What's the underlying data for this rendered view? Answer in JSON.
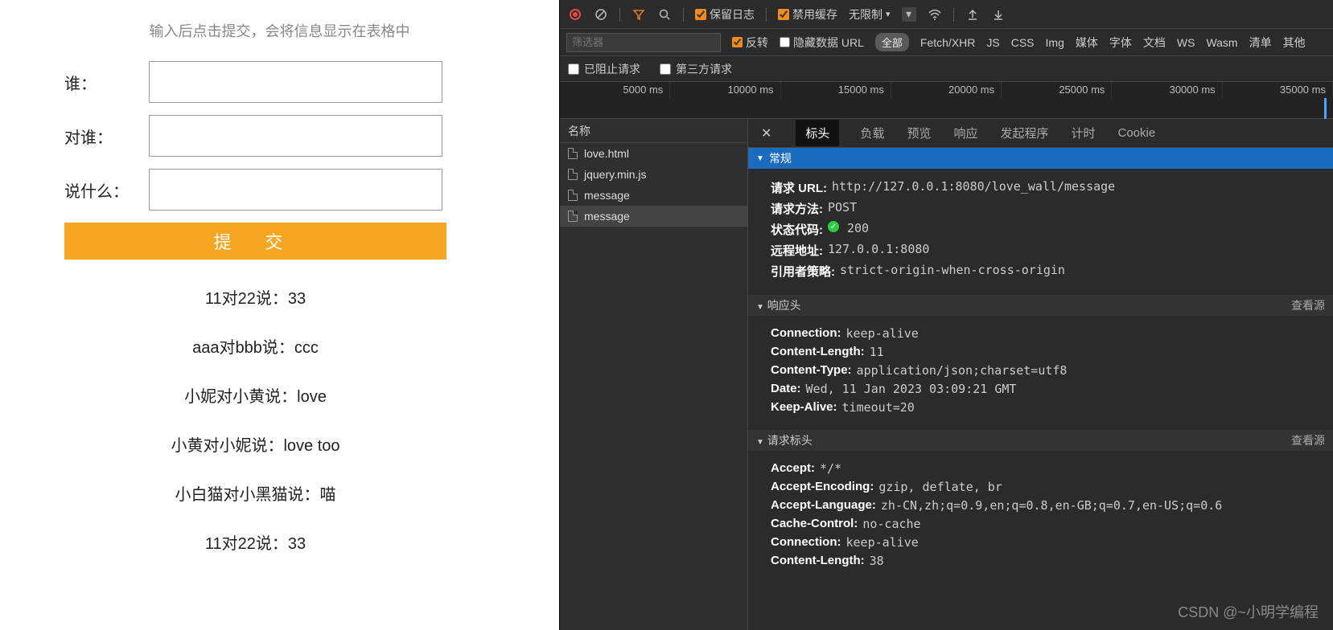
{
  "form": {
    "subtitle": "输入后点击提交，会将信息显示在表格中",
    "labels": {
      "who": "谁：",
      "toWhom": "对谁：",
      "sayWhat": "说什么："
    },
    "submit": "提 交",
    "messages": [
      "11对22说：33",
      "aaa对bbb说：ccc",
      "小妮对小黄说：love",
      "小黄对小妮说：love too",
      "小白猫对小黑猫说：喵",
      "11对22说：33"
    ]
  },
  "toolbar": {
    "preserveLog": "保留日志",
    "disableCache": "禁用缓存",
    "throttle": "无限制"
  },
  "filterbar": {
    "placeholder": "筛选器",
    "invert": "反转",
    "hideDataUrl": "隐藏数据 URL",
    "all": "全部",
    "types": [
      "Fetch/XHR",
      "JS",
      "CSS",
      "Img",
      "媒体",
      "字体",
      "文档",
      "WS",
      "Wasm",
      "清单",
      "其他"
    ]
  },
  "optbar": {
    "blocked": "已阻止请求",
    "thirdParty": "第三方请求"
  },
  "timeline": [
    "5000 ms",
    "10000 ms",
    "15000 ms",
    "20000 ms",
    "25000 ms",
    "30000 ms",
    "35000 ms"
  ],
  "requests": {
    "header": "名称",
    "items": [
      "love.html",
      "jquery.min.js",
      "message",
      "message"
    ],
    "selectedIndex": 3
  },
  "detailTabs": {
    "headers": "标头",
    "payload": "负载",
    "preview": "预览",
    "response": "响应",
    "initiator": "发起程序",
    "timing": "计时",
    "cookies": "Cookie"
  },
  "sections": {
    "general": "常规",
    "responseHeaders": "响应头",
    "requestHeaders": "请求标头",
    "viewSource": "查看源"
  },
  "general": {
    "requestUrlLabel": "请求 URL:",
    "requestUrl": "http://127.0.0.1:8080/love_wall/message",
    "methodLabel": "请求方法:",
    "method": "POST",
    "statusLabel": "状态代码:",
    "status": "200",
    "remoteLabel": "远程地址:",
    "remote": "127.0.0.1:8080",
    "referrerLabel": "引用者策略:",
    "referrer": "strict-origin-when-cross-origin"
  },
  "responseHeaders": [
    {
      "k": "Connection:",
      "v": "keep-alive"
    },
    {
      "k": "Content-Length:",
      "v": "11"
    },
    {
      "k": "Content-Type:",
      "v": "application/json;charset=utf8"
    },
    {
      "k": "Date:",
      "v": "Wed, 11 Jan 2023 03:09:21 GMT"
    },
    {
      "k": "Keep-Alive:",
      "v": "timeout=20"
    }
  ],
  "requestHeaders": [
    {
      "k": "Accept:",
      "v": "*/*"
    },
    {
      "k": "Accept-Encoding:",
      "v": "gzip, deflate, br"
    },
    {
      "k": "Accept-Language:",
      "v": "zh-CN,zh;q=0.9,en;q=0.8,en-GB;q=0.7,en-US;q=0.6"
    },
    {
      "k": "Cache-Control:",
      "v": "no-cache"
    },
    {
      "k": "Connection:",
      "v": "keep-alive"
    },
    {
      "k": "Content-Length:",
      "v": "38"
    }
  ],
  "watermark": "CSDN @~小明学编程"
}
